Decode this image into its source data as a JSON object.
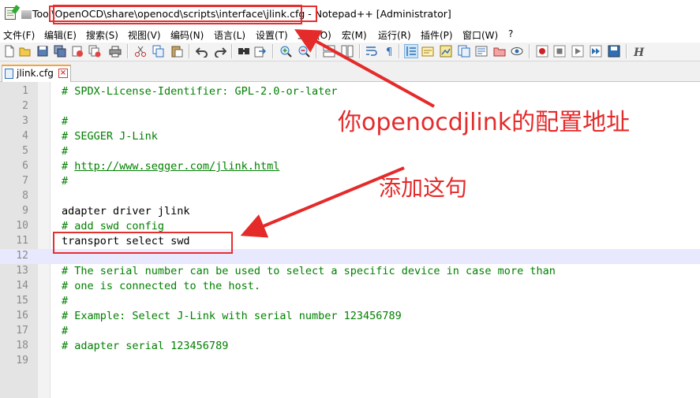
{
  "window": {
    "title_prefix": "Tool",
    "title_path": "\\OpenOCD\\share\\openocd\\scripts\\interface\\jlink.cfg - ",
    "title_suffix": "Notepad++ [Administrator]"
  },
  "menu": [
    "文件(F)",
    "编辑(E)",
    "搜索(S)",
    "视图(V)",
    "编码(N)",
    "语言(L)",
    "设置(T)",
    "工具(O)",
    "宏(M)",
    "运行(R)",
    "插件(P)",
    "窗口(W)",
    "?"
  ],
  "toolbar": {
    "icons": [
      "new-file-icon",
      "open-file-icon",
      "save-icon",
      "save-all-icon",
      "close-icon",
      "close-all-icon",
      "print-icon",
      "cut-icon",
      "copy-icon",
      "paste-icon",
      "undo-icon",
      "redo-icon",
      "find-icon",
      "replace-icon",
      "zoom-in-icon",
      "zoom-out-icon",
      "sync-vertical-icon",
      "sync-horizontal-icon",
      "word-wrap-icon",
      "show-all-chars-icon",
      "indent-guide-icon",
      "user-lang-icon",
      "doc-map-icon",
      "function-list-icon",
      "folder-workspace-icon",
      "monitoring-icon",
      "record-macro-icon",
      "stop-record-icon",
      "play-macro-icon",
      "run-macro-multiple-icon",
      "save-macro-icon",
      "spell-check-icon"
    ],
    "colors": {
      "red": "#cc2222",
      "blue": "#2f6fb5",
      "green": "#3a9a3a",
      "gray": "#666666"
    }
  },
  "tab": {
    "label": "jlink.cfg",
    "close": "×"
  },
  "editor": {
    "lines": [
      {
        "n": "1",
        "text": "# SPDX-License-Identifier: GPL-2.0-or-later",
        "type": "comment"
      },
      {
        "n": "2",
        "text": "",
        "type": "plain"
      },
      {
        "n": "3",
        "text": "#",
        "type": "comment"
      },
      {
        "n": "4",
        "text": "# SEGGER J-Link",
        "type": "comment"
      },
      {
        "n": "5",
        "text": "#",
        "type": "comment"
      },
      {
        "n": "6",
        "text": "# ",
        "url": "http://www.segger.com/jlink.html",
        "type": "comment"
      },
      {
        "n": "7",
        "text": "#",
        "type": "comment"
      },
      {
        "n": "8",
        "text": "",
        "type": "plain"
      },
      {
        "n": "9",
        "text": "adapter driver jlink",
        "type": "plain"
      },
      {
        "n": "10",
        "text": "# add swd config",
        "type": "comment"
      },
      {
        "n": "11",
        "text": "transport select swd",
        "type": "plain"
      },
      {
        "n": "12",
        "text": "",
        "type": "plain",
        "current": true
      },
      {
        "n": "13",
        "text": "# The serial number can be used to select a specific device in case more than",
        "type": "comment"
      },
      {
        "n": "14",
        "text": "# one is connected to the host.",
        "type": "comment"
      },
      {
        "n": "15",
        "text": "#",
        "type": "comment"
      },
      {
        "n": "16",
        "text": "# Example: Select J-Link with serial number 123456789",
        "type": "comment"
      },
      {
        "n": "17",
        "text": "#",
        "type": "comment"
      },
      {
        "n": "18",
        "text": "# adapter serial 123456789",
        "type": "comment"
      },
      {
        "n": "19",
        "text": "",
        "type": "plain"
      }
    ]
  },
  "annotations": {
    "path_note": "你openocdjlink的配置地址",
    "add_note": "添加这句",
    "color": "#e52a2a"
  }
}
